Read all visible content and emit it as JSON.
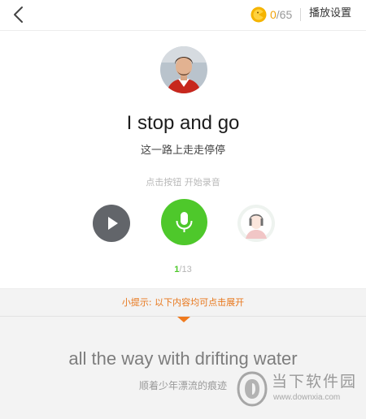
{
  "header": {
    "coins_current": "0",
    "coins_total": "/65",
    "settings_label": "播放设置"
  },
  "lesson": {
    "sentence_en": "I stop and go",
    "sentence_zh": "这一路上走走停停",
    "hint": "点击按钮 开始录音"
  },
  "pager": {
    "current": "1",
    "total": "/13"
  },
  "tip": {
    "text": "小提示: 以下内容均可点击展开"
  },
  "next": {
    "sentence_en": "all the way with drifting water",
    "sentence_zh": "顺着少年漂流的痕迹"
  },
  "watermark": {
    "name": "当下软件园",
    "url": "www.downxia.com"
  },
  "colors": {
    "accent_green": "#4ec82b",
    "accent_orange": "#e8761a",
    "coin_yellow": "#f5b400"
  }
}
